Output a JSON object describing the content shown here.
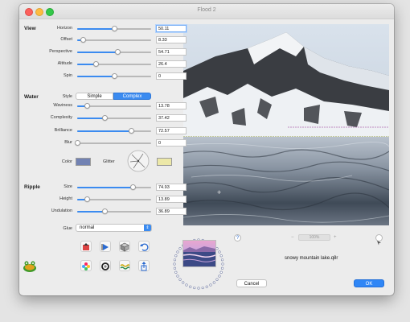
{
  "window": {
    "title": "Flood 2"
  },
  "view": {
    "section": "View",
    "sliders": [
      {
        "label": "Horizon",
        "value": "50.11",
        "fraction": 0.5
      },
      {
        "label": "Offset",
        "value": "8.33",
        "fraction": 0.08
      },
      {
        "label": "Perspective",
        "value": "54.71",
        "fraction": 0.55
      },
      {
        "label": "Altitude",
        "value": "26.4",
        "fraction": 0.26
      },
      {
        "label": "Spin",
        "value": "0",
        "fraction": 0.5
      }
    ]
  },
  "water": {
    "section": "Water",
    "style_label": "Style",
    "style_options": [
      "Simple",
      "Complex"
    ],
    "style_selected": "Complex",
    "sliders": [
      {
        "label": "Waviness",
        "value": "13.78",
        "fraction": 0.14
      },
      {
        "label": "Complexity",
        "value": "37.42",
        "fraction": 0.37
      },
      {
        "label": "Brilliance",
        "value": "72.57",
        "fraction": 0.73
      },
      {
        "label": "Blur",
        "value": "0",
        "fraction": 0.0
      }
    ],
    "color_label": "Color",
    "color_value": "#7282b3",
    "glitter_label": "Glitter",
    "glitter_color": "#ece8a8"
  },
  "ripple": {
    "section": "Ripple",
    "sliders": [
      {
        "label": "Size",
        "value": "74.93",
        "fraction": 0.75
      },
      {
        "label": "Height",
        "value": "13.89",
        "fraction": 0.14
      },
      {
        "label": "Undulation",
        "value": "36.89",
        "fraction": 0.37
      }
    ]
  },
  "glue": {
    "label": "Glue",
    "value": "normal"
  },
  "tools": [
    "open-icon",
    "play-icon",
    "cube-icon",
    "undo-icon",
    "color-wheel-icon",
    "ring-icon",
    "wave-icon",
    "share-icon"
  ],
  "logo": "frog-logo-icon",
  "preview": {
    "zoom": "100%",
    "help": "?",
    "filename": "snowy mountain lake.q8r",
    "crosshair": "+"
  },
  "buttons": {
    "cancel": "Cancel",
    "ok": "OK"
  },
  "colors": {
    "accent": "#3b8bf0",
    "ok": "#2f86f6"
  }
}
